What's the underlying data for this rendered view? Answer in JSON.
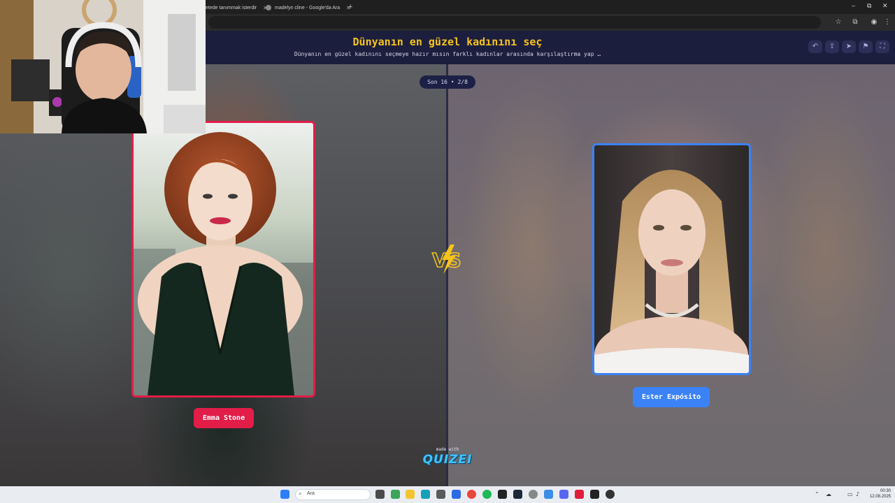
{
  "browser": {
    "tabs": [
      {
        "label": "etede tanımmak isterdir"
      },
      {
        "label": "madelyn cline - Google'da Ara"
      }
    ],
    "new_tab": "+",
    "window_controls": {
      "minimize": "–",
      "maximize": "⧉",
      "close": "✕"
    }
  },
  "site": {
    "title": "Dünyanın en güzel kadınını seç",
    "subtitle": "Dünyanın en güzel kadınını seçmeye hazır mısın farklı kadınlar arasında karşılaştırma yap …",
    "header_buttons": [
      "undo-icon",
      "share-icon",
      "send-icon",
      "flag-icon",
      "fullscreen-icon"
    ]
  },
  "round": {
    "label": "Son 16 • 2/8"
  },
  "contestants": {
    "left": {
      "name": "Emma Stone",
      "accent": "#e11d48"
    },
    "right": {
      "name": "Ester Expósito",
      "accent": "#3b82f6"
    }
  },
  "vs": {
    "label": "VS"
  },
  "footer": {
    "made_with": "made with",
    "brand": "QUIZEI"
  },
  "taskbar": {
    "search_placeholder": "Ara",
    "time": "00:30",
    "date": "12.08.2025"
  }
}
